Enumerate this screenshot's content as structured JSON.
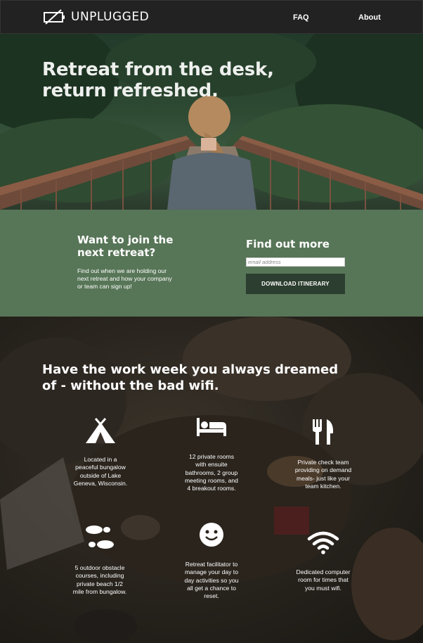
{
  "header": {
    "brand": "UNPLUGGED",
    "nav": [
      {
        "label": "FAQ"
      },
      {
        "label": "About"
      }
    ]
  },
  "hero": {
    "headline": "Retreat from the desk, return refreshed."
  },
  "signup": {
    "title": "Want to join the next retreat?",
    "text": "Find out when we are holding our next retreat and how your company or team can sign up!",
    "findout_title": "Find out more",
    "email_placeholder": "email address",
    "button_label": "DOWNLOAD ITINERARY"
  },
  "features": {
    "title": "Have the work week you always dreamed of - without the bad wifi.",
    "items": [
      {
        "icon": "tent-icon",
        "text": "Located in a peaceful bungalow outside of Lake Geneva, Wisconsin."
      },
      {
        "icon": "bed-icon",
        "text": "12 private rooms with ensuite bathrooms, 2 group meeting rooms, and 4 breakout rooms."
      },
      {
        "icon": "utensils-icon",
        "text": "Private check team providing on demand meals- just like your team kitchen."
      },
      {
        "icon": "footprints-icon",
        "text": "5 outdoor obstacle courses, including private beach 1/2 mile from bungalow."
      },
      {
        "icon": "smile-icon",
        "text": "Retreat facilitator to manage your day to day activities so you all get a chance to reset."
      },
      {
        "icon": "wifi-icon",
        "text": "Dedicated computer room for times that you must wifi."
      }
    ]
  },
  "colors": {
    "header_bg": "#222222",
    "signup_bg": "#577557",
    "button_bg": "#2c3e2f"
  }
}
